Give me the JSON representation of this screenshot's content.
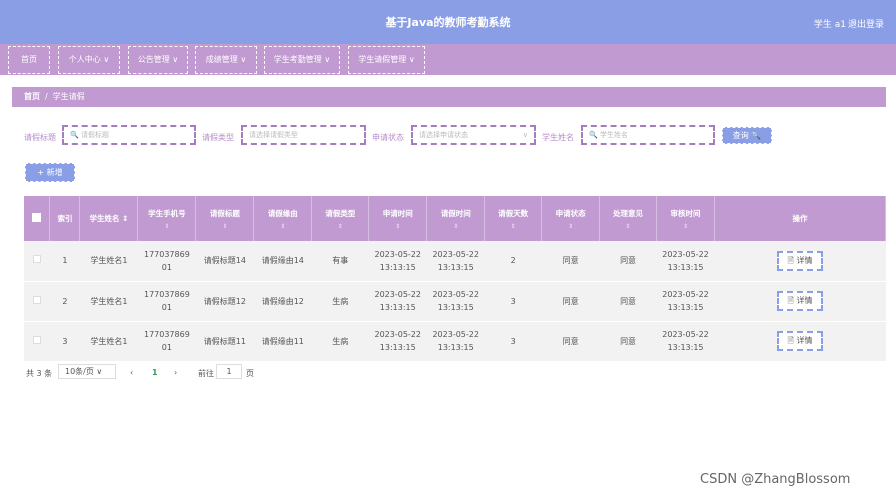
{
  "header": {
    "title": "基于Java的教师考勤系统",
    "user": "学生 a1",
    "logout": "退出登录"
  },
  "menu": [
    {
      "label": "首页"
    },
    {
      "label": "个人中心 ∨"
    },
    {
      "label": "公告管理 ∨"
    },
    {
      "label": "成绩管理 ∨"
    },
    {
      "label": "学生考勤管理 ∨"
    },
    {
      "label": "学生请假管理 ∨"
    }
  ],
  "breadcrumb": {
    "home": "首页",
    "sep": "/",
    "current": "学生请假"
  },
  "filters": {
    "title_label": "请假标题",
    "title_placeholder": "🔍 请假标题",
    "type_label": "请假类型",
    "type_placeholder": "请选择请假类型",
    "status_label": "申请状态",
    "status_placeholder": "请选择申请状态",
    "name_label": "学生姓名",
    "name_placeholder": "🔍 学生姓名",
    "search": "查询 🔍"
  },
  "add_button": "+ 新增",
  "table": {
    "headers": [
      "索引",
      "学生姓名 ↕",
      "学生手机号",
      "请假标题",
      "请假缘由",
      "请假类型",
      "申请时间",
      "请假时间",
      "请假天数",
      "申请状态",
      "处理意见",
      "审核时间",
      "操作"
    ],
    "sort_glyph": "⇕",
    "rows": [
      {
        "index": "1",
        "name": "学生姓名1",
        "phone1": "177037869",
        "phone2": "01",
        "title": "请假标题14",
        "reason": "请假缘由14",
        "type": "有事",
        "apply1": "2023-05-22",
        "apply2": "13:13:15",
        "leave1": "2023-05-22",
        "leave2": "13:13:15",
        "days": "2",
        "status": "同意",
        "opinion": "同意",
        "audit1": "2023-05-22",
        "audit2": "13:13:15",
        "action": "🗎 详情"
      },
      {
        "index": "2",
        "name": "学生姓名1",
        "phone1": "177037869",
        "phone2": "01",
        "title": "请假标题12",
        "reason": "请假缘由12",
        "type": "生病",
        "apply1": "2023-05-22",
        "apply2": "13:13:15",
        "leave1": "2023-05-22",
        "leave2": "13:13:15",
        "days": "3",
        "status": "同意",
        "opinion": "同意",
        "audit1": "2023-05-22",
        "audit2": "13:13:15",
        "action": "🗎 详情"
      },
      {
        "index": "3",
        "name": "学生姓名1",
        "phone1": "177037869",
        "phone2": "01",
        "title": "请假标题11",
        "reason": "请假缘由11",
        "type": "生病",
        "apply1": "2023-05-22",
        "apply2": "13:13:15",
        "leave1": "2023-05-22",
        "leave2": "13:13:15",
        "days": "3",
        "status": "同意",
        "opinion": "同意",
        "audit1": "2023-05-22",
        "audit2": "13:13:15",
        "action": "🗎 详情"
      }
    ]
  },
  "pagination": {
    "total": "共 3 条",
    "size": "10条/页 ∨",
    "prev": "‹",
    "page": "1",
    "next": "›",
    "goto": "前往",
    "goto_value": "1",
    "page_unit": "页"
  },
  "watermark": "CSDN @ZhangBlossom"
}
